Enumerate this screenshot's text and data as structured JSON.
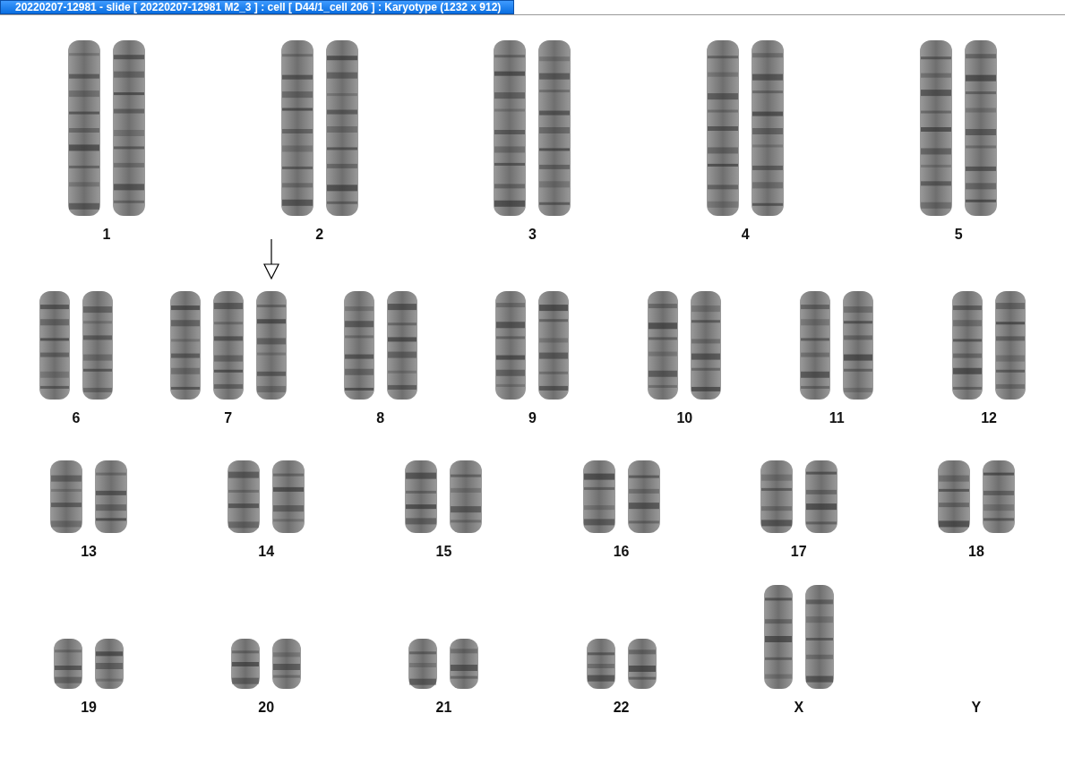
{
  "window": {
    "title": "20220207-12981 - slide [ 20220207-12981 M2_3 ] : cell [ D44/1_cell 206 ] : Karyotype  (1232 x 912)"
  },
  "rows": [
    {
      "groups": [
        {
          "label": "1",
          "kind": "autosome",
          "copies": [
            {
              "marked": false
            },
            {
              "marked": false
            }
          ]
        },
        {
          "label": "2",
          "kind": "autosome",
          "copies": [
            {
              "marked": false
            },
            {
              "marked": false
            }
          ]
        },
        {
          "label": "3",
          "kind": "autosome",
          "copies": [
            {
              "marked": false
            },
            {
              "marked": false
            }
          ]
        },
        {
          "label": "4",
          "kind": "autosome",
          "copies": [
            {
              "marked": false
            },
            {
              "marked": false
            }
          ]
        },
        {
          "label": "5",
          "kind": "autosome",
          "copies": [
            {
              "marked": false
            },
            {
              "marked": false
            }
          ]
        }
      ]
    },
    {
      "groups": [
        {
          "label": "6",
          "kind": "autosome",
          "copies": [
            {
              "marked": false
            },
            {
              "marked": false
            }
          ]
        },
        {
          "label": "7",
          "kind": "autosome",
          "copies": [
            {
              "marked": false
            },
            {
              "marked": false
            },
            {
              "marked": true
            }
          ]
        },
        {
          "label": "8",
          "kind": "autosome",
          "copies": [
            {
              "marked": false
            },
            {
              "marked": false
            }
          ]
        },
        {
          "label": "9",
          "kind": "autosome",
          "copies": [
            {
              "marked": false
            },
            {
              "marked": false
            }
          ]
        },
        {
          "label": "10",
          "kind": "autosome",
          "copies": [
            {
              "marked": false
            },
            {
              "marked": false
            }
          ]
        },
        {
          "label": "11",
          "kind": "autosome",
          "copies": [
            {
              "marked": false
            },
            {
              "marked": false
            }
          ]
        },
        {
          "label": "12",
          "kind": "autosome",
          "copies": [
            {
              "marked": false
            },
            {
              "marked": false
            }
          ]
        }
      ]
    },
    {
      "groups": [
        {
          "label": "13",
          "kind": "autosome",
          "copies": [
            {
              "marked": false
            },
            {
              "marked": false
            }
          ]
        },
        {
          "label": "14",
          "kind": "autosome",
          "copies": [
            {
              "marked": false
            },
            {
              "marked": false
            }
          ]
        },
        {
          "label": "15",
          "kind": "autosome",
          "copies": [
            {
              "marked": false
            },
            {
              "marked": false
            }
          ]
        },
        {
          "label": "16",
          "kind": "autosome",
          "copies": [
            {
              "marked": false
            },
            {
              "marked": false
            }
          ]
        },
        {
          "label": "17",
          "kind": "autosome",
          "copies": [
            {
              "marked": false
            },
            {
              "marked": false
            }
          ]
        },
        {
          "label": "18",
          "kind": "autosome",
          "copies": [
            {
              "marked": false
            },
            {
              "marked": false
            }
          ]
        }
      ]
    },
    {
      "groups": [
        {
          "label": "19",
          "kind": "autosome",
          "copies": [
            {
              "marked": false
            },
            {
              "marked": false
            }
          ]
        },
        {
          "label": "20",
          "kind": "autosome",
          "copies": [
            {
              "marked": false
            },
            {
              "marked": false
            }
          ]
        },
        {
          "label": "21",
          "kind": "autosome",
          "copies": [
            {
              "marked": false
            },
            {
              "marked": false
            }
          ]
        },
        {
          "label": "22",
          "kind": "autosome",
          "copies": [
            {
              "marked": false
            },
            {
              "marked": false
            }
          ]
        },
        {
          "label": "X",
          "kind": "sex",
          "copies": [
            {
              "marked": false
            },
            {
              "marked": false
            }
          ]
        },
        {
          "label": "Y",
          "kind": "sex"
        }
      ]
    }
  ]
}
